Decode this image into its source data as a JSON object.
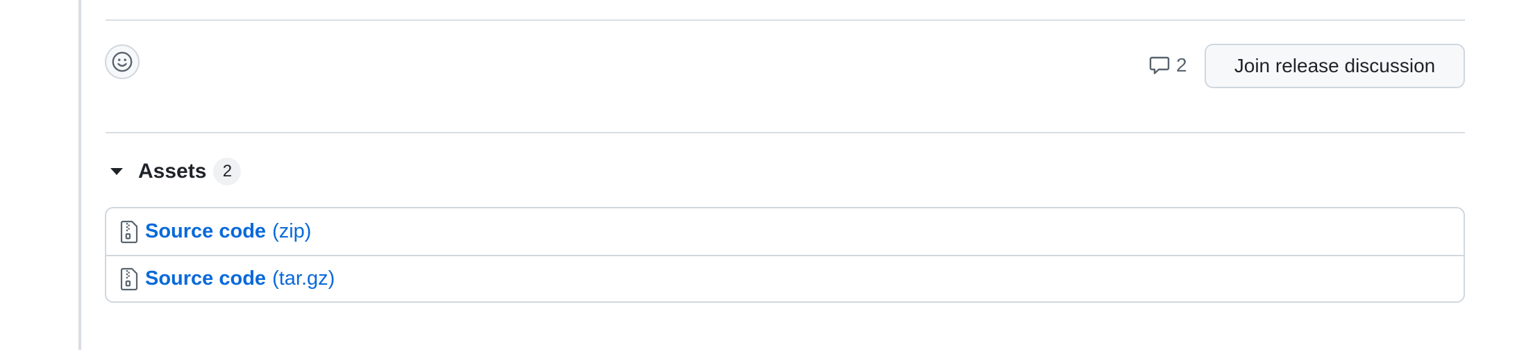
{
  "reactions": {
    "icon": "smiley-icon"
  },
  "discussion": {
    "icon": "comment-icon",
    "comment_count": "2",
    "join_label": "Join release discussion"
  },
  "assets": {
    "title": "Assets",
    "count": "2",
    "items": [
      {
        "icon": "file-zip-icon",
        "name": "Source code",
        "ext": "(zip)"
      },
      {
        "icon": "file-zip-icon",
        "name": "Source code",
        "ext": "(tar.gz)"
      }
    ]
  },
  "colors": {
    "link": "#0969da",
    "border": "#d0d7de",
    "button_bg": "#f6f8fa",
    "counter_bg": "#eff1f3",
    "muted_text": "#59636e"
  }
}
